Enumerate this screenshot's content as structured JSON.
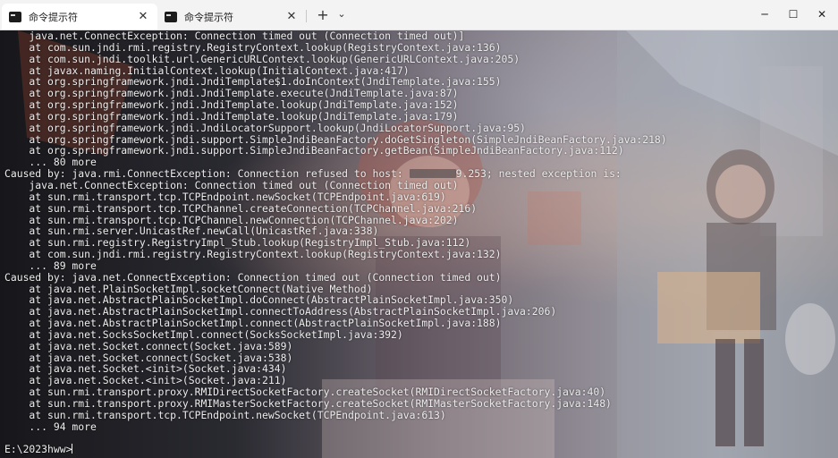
{
  "tabs": [
    {
      "label": "命令提示符",
      "icon": "cmd-icon",
      "active": true,
      "close": "✕"
    },
    {
      "label": "命令提示符",
      "icon": "cmd-icon",
      "active": false,
      "close": "✕"
    }
  ],
  "titlebar": {
    "new_tab": "+",
    "dropdown": "⌄",
    "minimize": "─",
    "maximize": "☐",
    "close": "✕"
  },
  "console": {
    "lines": [
      "    java.net.ConnectException: Connection timed out (Connection timed out)]",
      "    at com.sun.jndi.rmi.registry.RegistryContext.lookup(RegistryContext.java:136)",
      "    at com.sun.jndi.toolkit.url.GenericURLContext.lookup(GenericURLContext.java:205)",
      "    at javax.naming.InitialContext.lookup(InitialContext.java:417)",
      "    at org.springframework.jndi.JndiTemplate$1.doInContext(JndiTemplate.java:155)",
      "    at org.springframework.jndi.JndiTemplate.execute(JndiTemplate.java:87)",
      "    at org.springframework.jndi.JndiTemplate.lookup(JndiTemplate.java:152)",
      "    at org.springframework.jndi.JndiTemplate.lookup(JndiTemplate.java:179)",
      "    at org.springframework.jndi.JndiLocatorSupport.lookup(JndiLocatorSupport.java:95)",
      "    at org.springframework.jndi.support.SimpleJndiBeanFactory.doGetSingleton(SimpleJndiBeanFactory.java:218)",
      "    at org.springframework.jndi.support.SimpleJndiBeanFactory.getBean(SimpleJndiBeanFactory.java:112)",
      "    ... 80 more"
    ],
    "refused_prefix": "Caused by: java.rmi.ConnectException: Connection refused to host: ",
    "refused_suffix": "9.253; nested exception is:",
    "lines2": [
      "    java.net.ConnectException: Connection timed out (Connection timed out)",
      "    at sun.rmi.transport.tcp.TCPEndpoint.newSocket(TCPEndpoint.java:619)",
      "    at sun.rmi.transport.tcp.TCPChannel.createConnection(TCPChannel.java:216)",
      "    at sun.rmi.transport.tcp.TCPChannel.newConnection(TCPChannel.java:202)",
      "    at sun.rmi.server.UnicastRef.newCall(UnicastRef.java:338)",
      "    at sun.rmi.registry.RegistryImpl_Stub.lookup(RegistryImpl_Stub.java:112)",
      "    at com.sun.jndi.rmi.registry.RegistryContext.lookup(RegistryContext.java:132)",
      "    ... 89 more",
      "Caused by: java.net.ConnectException: Connection timed out (Connection timed out)",
      "    at java.net.PlainSocketImpl.socketConnect(Native Method)",
      "    at java.net.AbstractPlainSocketImpl.doConnect(AbstractPlainSocketImpl.java:350)",
      "    at java.net.AbstractPlainSocketImpl.connectToAddress(AbstractPlainSocketImpl.java:206)",
      "    at java.net.AbstractPlainSocketImpl.connect(AbstractPlainSocketImpl.java:188)",
      "    at java.net.SocksSocketImpl.connect(SocksSocketImpl.java:392)",
      "    at java.net.Socket.connect(Socket.java:589)",
      "    at java.net.Socket.connect(Socket.java:538)",
      "    at java.net.Socket.<init>(Socket.java:434)",
      "    at java.net.Socket.<init>(Socket.java:211)",
      "    at sun.rmi.transport.proxy.RMIDirectSocketFactory.createSocket(RMIDirectSocketFactory.java:40)",
      "    at sun.rmi.transport.proxy.RMIMasterSocketFactory.createSocket(RMIMasterSocketFactory.java:148)",
      "    at sun.rmi.transport.tcp.TCPEndpoint.newSocket(TCPEndpoint.java:613)",
      "    ... 94 more",
      ""
    ],
    "prompt": "E:\\2023hww>"
  },
  "colors": {
    "titlebar": "#f3f3f3",
    "active_tab": "#ffffff",
    "console_text": "#ededed"
  }
}
